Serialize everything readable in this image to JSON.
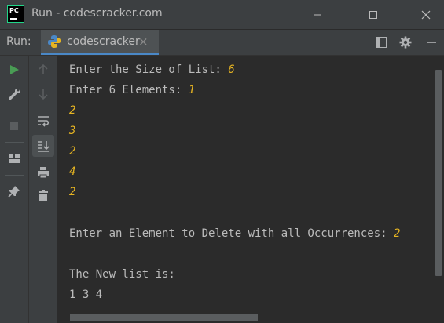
{
  "window": {
    "title": "Run - codescracker.com",
    "logo_text": "PC"
  },
  "run_toolbar": {
    "label": "Run:",
    "tab_label": "codescracker",
    "tab_close": "×"
  },
  "console": {
    "lines": [
      {
        "text": "Enter the Size of List: ",
        "input": "6"
      },
      {
        "text": "Enter 6 Elements: ",
        "input": "1"
      },
      {
        "text": "",
        "input": "2"
      },
      {
        "text": "",
        "input": "3"
      },
      {
        "text": "",
        "input": "2"
      },
      {
        "text": "",
        "input": "4"
      },
      {
        "text": "",
        "input": "2"
      },
      {
        "text": "",
        "input": ""
      },
      {
        "text": "Enter an Element to Delete with all Occurrences: ",
        "input": "2"
      },
      {
        "text": "",
        "input": ""
      },
      {
        "text": "The New list is:",
        "input": ""
      },
      {
        "text": "1 3 4",
        "input": ""
      }
    ]
  },
  "colors": {
    "background": "#2b2b2b",
    "panel": "#3c3f41",
    "text": "#bbbbbb",
    "input_text": "#e6b422",
    "run_green": "#499c54",
    "tab_underline": "#4a88c7"
  },
  "icons": {
    "run": "run-icon",
    "wrench": "wrench-icon",
    "stop": "stop-icon",
    "layout": "layout-icon",
    "pin": "pin-icon",
    "up": "arrow-up-icon",
    "down": "arrow-down-icon",
    "soft_wrap": "soft-wrap-icon",
    "scroll_end": "scroll-to-end-icon",
    "print": "print-icon",
    "trash": "trash-icon",
    "restore_layout": "restore-layout-icon",
    "settings": "gear-icon",
    "hide": "minimize-panel-icon"
  }
}
